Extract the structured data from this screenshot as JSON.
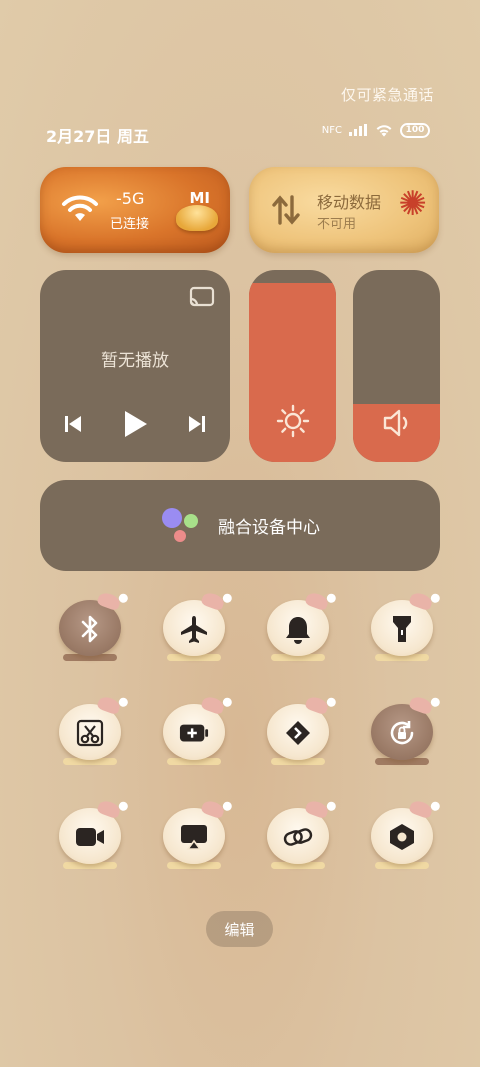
{
  "status": {
    "emergency_text": "仅可紧急通话",
    "date_text": "2月27日 周五",
    "battery": "100",
    "nfc_label": "NFC"
  },
  "wifi_tile": {
    "title": "-5G",
    "subtitle": "已连接",
    "badge": "MI",
    "icon": "wifi-icon"
  },
  "data_tile": {
    "title": "移动数据",
    "subtitle": "不可用",
    "icon": "arrows-updown-icon"
  },
  "media": {
    "text": "暂无播放"
  },
  "brightness": {
    "level": 0.93,
    "icon": "sun-icon"
  },
  "volume": {
    "level": 0.3,
    "icon": "speaker-icon"
  },
  "fusion": {
    "label": "融合设备中心"
  },
  "toggles": [
    {
      "id": "bluetooth",
      "icon": "bluetooth-icon",
      "on": true
    },
    {
      "id": "airplane",
      "icon": "airplane-icon",
      "on": false
    },
    {
      "id": "bell",
      "icon": "bell-icon",
      "on": false
    },
    {
      "id": "flashlight",
      "icon": "flashlight-icon",
      "on": false
    },
    {
      "id": "screenshot",
      "icon": "scissors-icon",
      "on": false
    },
    {
      "id": "battery-saver",
      "icon": "battery-plus-icon",
      "on": false
    },
    {
      "id": "shortcut",
      "icon": "chevron-cross-icon",
      "on": false
    },
    {
      "id": "rotation-lock",
      "icon": "rotation-lock-icon",
      "on": true
    },
    {
      "id": "screen-record",
      "icon": "video-camera-icon",
      "on": false
    },
    {
      "id": "cast",
      "icon": "screen-cast-icon",
      "on": false
    },
    {
      "id": "link",
      "icon": "link-icon",
      "on": false
    },
    {
      "id": "settings",
      "icon": "hexagon-settings-icon",
      "on": false
    }
  ],
  "edit_label": "编辑",
  "colors": {
    "accent": "#d96a4d",
    "panel": "#7a6b5a"
  }
}
